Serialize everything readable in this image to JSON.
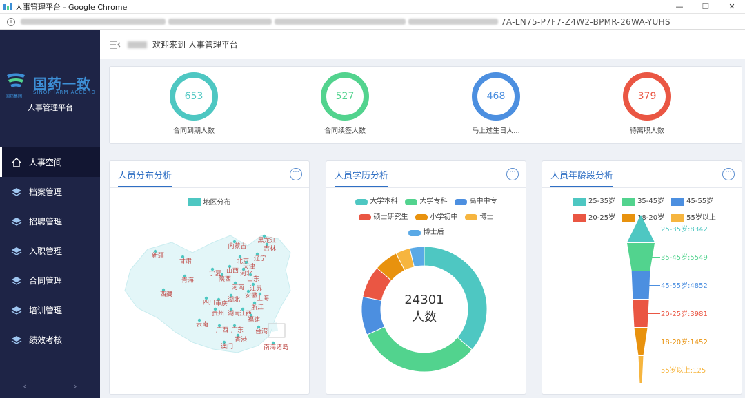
{
  "window": {
    "title": "人事管理平台 - Google Chrome",
    "url_tail": "7A-LN75-P7F7-Z4W2-BPMR-26WA-YUHS"
  },
  "brand": {
    "logo_cn": "国药一致",
    "logo_en": "SINOPHARM ACCORD",
    "logo_small": "国药集团",
    "platform_name": "人事管理平台"
  },
  "menu": [
    {
      "label": "人事空间",
      "icon": "home-icon",
      "active": true
    },
    {
      "label": "档案管理",
      "icon": "layers-icon"
    },
    {
      "label": "招聘管理",
      "icon": "layers-icon"
    },
    {
      "label": "入职管理",
      "icon": "layers-icon"
    },
    {
      "label": "合同管理",
      "icon": "layers-icon"
    },
    {
      "label": "培训管理",
      "icon": "layers-icon"
    },
    {
      "label": "绩效考核",
      "icon": "layers-icon"
    }
  ],
  "header": {
    "welcome": "欢迎来到 人事管理平台"
  },
  "stats": [
    {
      "value": "653",
      "label": "合同到期人数",
      "color": "#4ec7c2"
    },
    {
      "value": "527",
      "label": "合同续签人数",
      "color": "#52d38e"
    },
    {
      "value": "468",
      "label": "马上过生日人...",
      "color": "#4c8fe0"
    },
    {
      "value": "379",
      "label": "待离职人数",
      "color": "#ea5643"
    }
  ],
  "cards": {
    "map": {
      "title": "人员分布分析",
      "legend": "地区分布",
      "legend_color": "#4ec7c2",
      "regions": [
        "黑龙江",
        "吉林",
        "内蒙古",
        "辽宁",
        "北京",
        "天津",
        "山西",
        "河北",
        "山东",
        "新疆",
        "甘肃",
        "宁夏",
        "陕西",
        "河南",
        "江苏",
        "安徽",
        "上海",
        "青海",
        "西藏",
        "四川",
        "重庆",
        "湖北",
        "浙江",
        "贵州",
        "湖南",
        "江西",
        "福建",
        "云南",
        "广西",
        "广东",
        "台湾",
        "香港",
        "澳门",
        "南海诸岛"
      ]
    },
    "education": {
      "title": "人员学历分析",
      "center_value": "24301",
      "center_unit": "人数"
    },
    "age": {
      "title": "人员年龄段分析"
    }
  },
  "chart_data": [
    {
      "type": "pie",
      "title": "人员学历分析",
      "categories": [
        "大学本科",
        "大学专科",
        "高中中专",
        "硕士研究生",
        "小学初中",
        "博士",
        "博士后"
      ],
      "values": [
        8800,
        7800,
        2400,
        2000,
        1500,
        900,
        901
      ],
      "colors": [
        "#4ec7c2",
        "#52d38e",
        "#4c8fe0",
        "#ea5643",
        "#e8920e",
        "#f6b53f",
        "#5aa9e6"
      ],
      "total": 24301,
      "legend": "top"
    },
    {
      "type": "bar",
      "title": "人员年龄段分析",
      "categories": [
        "25-35岁",
        "35-45岁",
        "45-55岁",
        "20-25岁",
        "18-20岁",
        "55岁以上"
      ],
      "values": [
        8342,
        5549,
        4852,
        3981,
        1452,
        125
      ],
      "colors": [
        "#4ec7c2",
        "#52d38e",
        "#4c8fe0",
        "#ea5643",
        "#e8920e",
        "#f6b53f"
      ],
      "value_labels": [
        "25-35岁:8342",
        "35-45岁:5549",
        "45-55岁:4852",
        "20-25岁:3981",
        "18-20岁:1452",
        "55岁以上:125"
      ],
      "legend": "top"
    }
  ]
}
